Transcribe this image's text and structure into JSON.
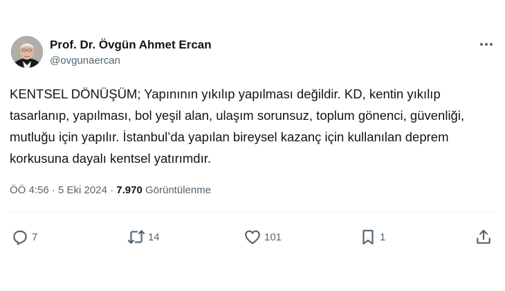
{
  "author": {
    "display_name": "Prof. Dr. Övgün Ahmet Ercan",
    "handle": "@ovgunaercan"
  },
  "tweet": {
    "text": "KENTSEL DÖNÜŞÜM; Yapınının yıkılıp yapılması değildir. KD, kentin yıkılıp tasarlanıp, yapılması, bol yeşil alan, ulaşım sorunsuz, toplum gönenci, güvenliği, mutluğu için yapılır. İstanbul’da yapılan bireysel kazanç için kullanılan deprem korkusuna dayalı kentsel yatırımdır."
  },
  "meta": {
    "time": "ÖÖ 4:56",
    "separator1": " · ",
    "date": "5 Eki 2024",
    "separator2": " · ",
    "views_count": "7.970",
    "views_label": " Görüntülenme"
  },
  "actions": {
    "replies": "7",
    "retweets": "14",
    "likes": "101",
    "bookmarks": "1"
  },
  "icons": {
    "more": "more-icon",
    "reply": "reply-icon",
    "retweet": "retweet-icon",
    "like": "heart-icon",
    "bookmark": "bookmark-icon",
    "share": "share-icon"
  },
  "colors": {
    "text_primary": "#0f1419",
    "text_secondary": "#536471",
    "divider": "#eff3f4"
  }
}
